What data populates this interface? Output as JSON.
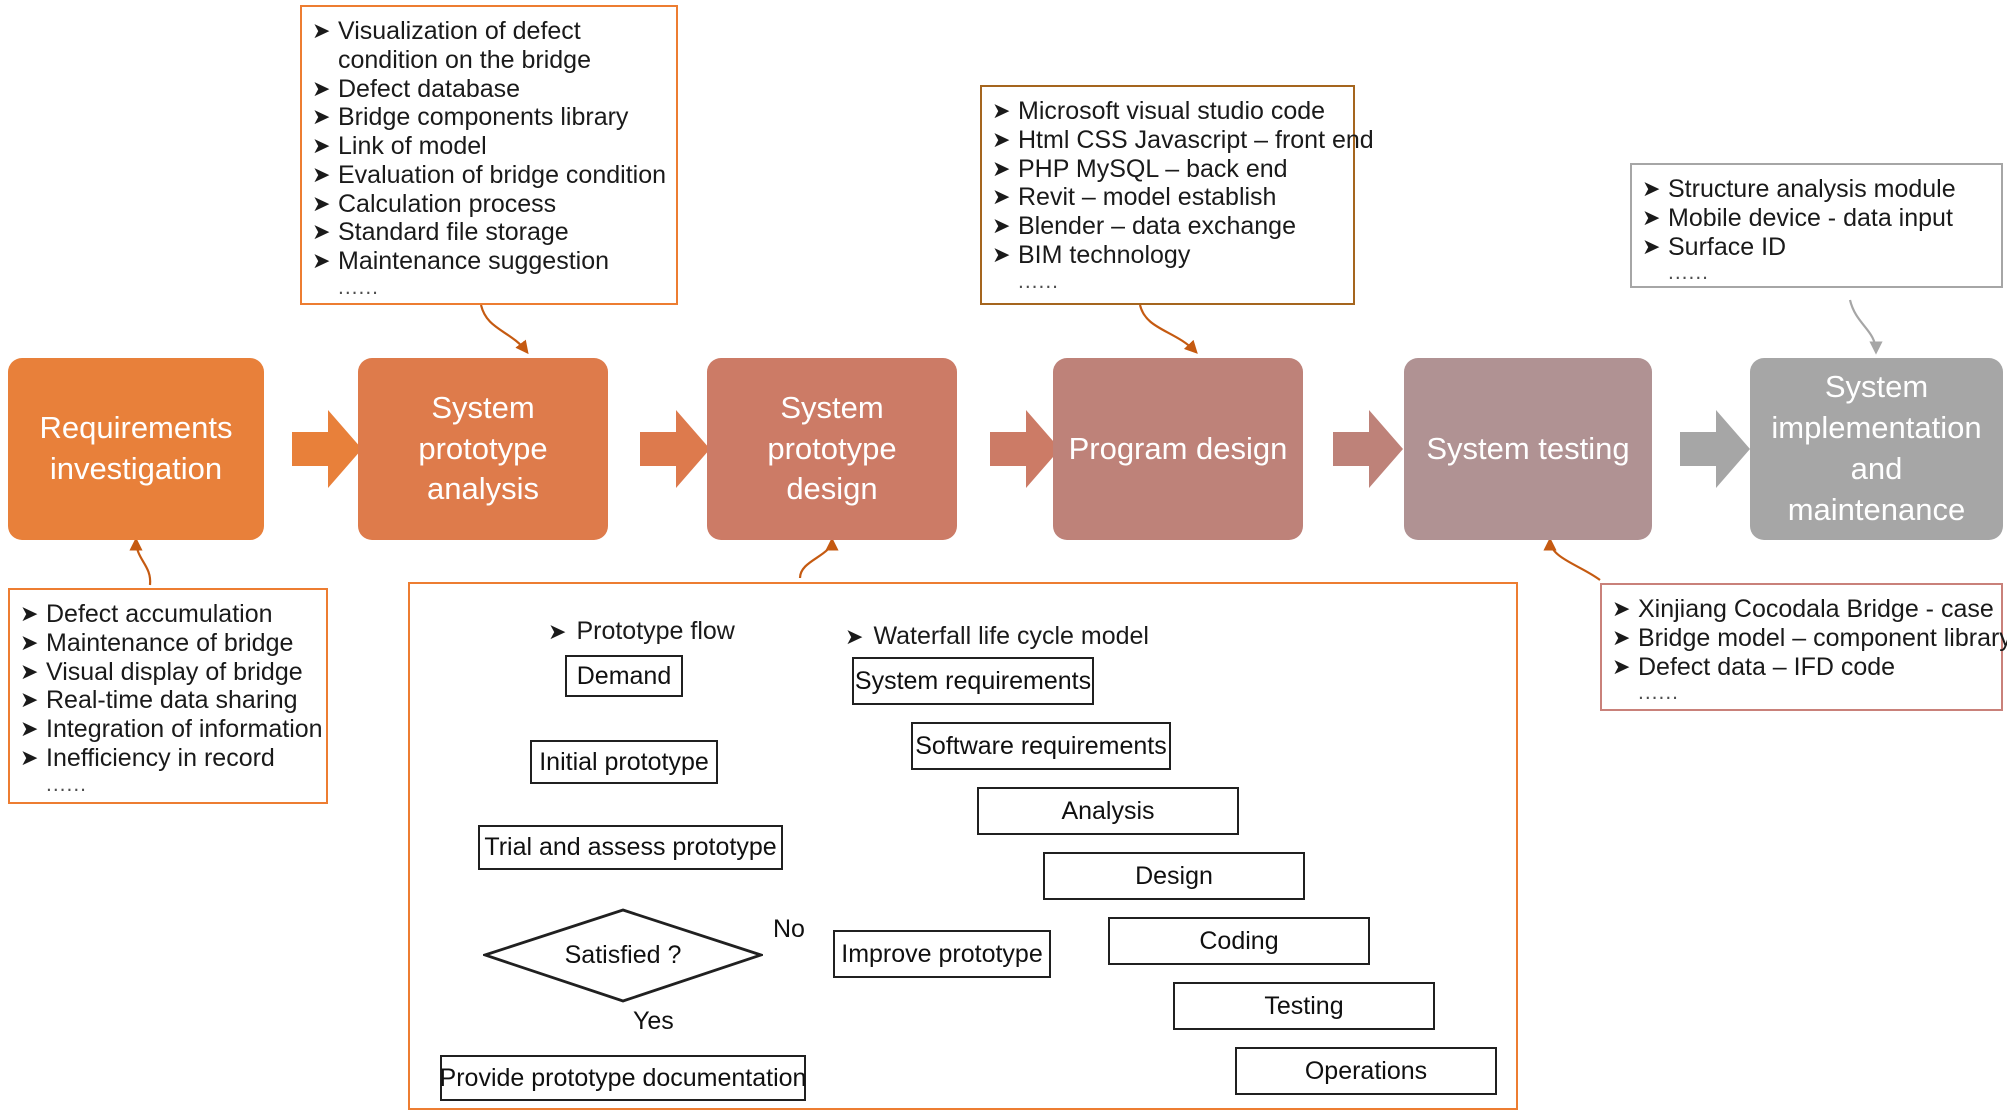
{
  "colors": {
    "orange_border": "#ED7D31",
    "brown_border": "#A5651E",
    "grey_border": "#A6A6A6",
    "rose_border": "#C9817A",
    "step1": "#E8803A",
    "step2": "#DE7B4B",
    "step3": "#CC7B66",
    "step4": "#BE8279",
    "step5": "#B09293",
    "step6": "#A6A6A6",
    "connector_blue": "#5B8FD4",
    "connector_orange": "#C55A11",
    "connector_grey": "#A6A6A6"
  },
  "notes": {
    "prototype_analysis": {
      "lines": [
        "Visualization of defect",
        "condition on the bridge",
        "Defect database",
        "Bridge components library",
        "Link of model",
        "Evaluation of bridge condition",
        "Calculation process",
        "Standard file storage",
        "Maintenance suggestion"
      ],
      "continuation_indices": [
        1
      ],
      "ellipsis": "......"
    },
    "program_design": {
      "lines": [
        "Microsoft visual studio code",
        "Html CSS Javascript – front end",
        "PHP MySQL – back end",
        "Revit – model establish",
        "Blender – data exchange",
        "BIM technology"
      ],
      "continuation_indices": [],
      "ellipsis": "......"
    },
    "implementation": {
      "lines": [
        "Structure analysis module",
        "Mobile device - data input",
        "Surface ID"
      ],
      "continuation_indices": [],
      "ellipsis": "......"
    },
    "requirements": {
      "lines": [
        "Defect accumulation",
        "Maintenance of bridge",
        "Visual display of bridge",
        "Real-time data sharing",
        "Integration of information",
        "Inefficiency in record"
      ],
      "continuation_indices": [],
      "ellipsis": "......"
    },
    "system_testing": {
      "lines": [
        "Xinjiang Cocodala Bridge - case",
        "Bridge model – component library",
        "Defect data – IFD code"
      ],
      "continuation_indices": [],
      "ellipsis": "......"
    }
  },
  "process": {
    "steps": [
      {
        "label": "Requirements\ninvestigation"
      },
      {
        "label": "System\nprototype\nanalysis"
      },
      {
        "label": "System\nprototype\ndesign"
      },
      {
        "label": "Program design"
      },
      {
        "label": "System testing"
      },
      {
        "label": "System\nimplementation\nand\nmaintenance"
      }
    ]
  },
  "bottom": {
    "prototype_flow": {
      "heading": "Prototype flow",
      "bullet": "➤",
      "nodes": [
        "Demand",
        "Initial prototype",
        "Trial and assess prototype",
        "Satisfied ?",
        "Improve prototype",
        "Provide prototype documentation"
      ],
      "edge_labels": {
        "no": "No",
        "yes": "Yes"
      }
    },
    "waterfall": {
      "heading": "Waterfall life cycle model",
      "bullet": "➤",
      "nodes": [
        "System requirements",
        "Software requirements",
        "Analysis",
        "Design",
        "Coding",
        "Testing",
        "Operations"
      ]
    }
  },
  "icons": {
    "bullet_arrow": "➤"
  }
}
